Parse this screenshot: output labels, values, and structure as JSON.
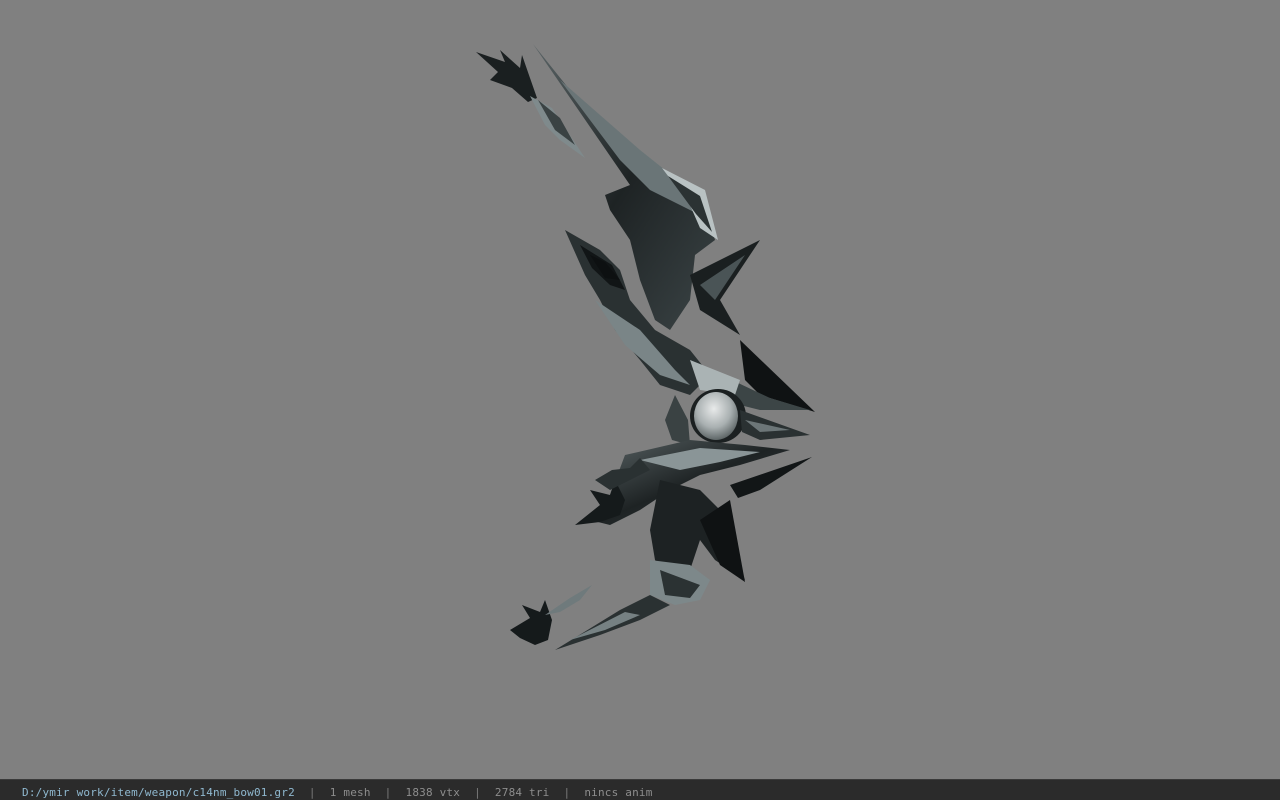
{
  "viewer": {
    "background_color": "#808080",
    "model_name": "bow-model"
  },
  "status": {
    "file_path": "D:/ymir work/item/weapon/c14nm_bow01.gr2",
    "mesh": "1 mesh",
    "vtx": "1838 vtx",
    "tri": "2784 tri",
    "anim": "nincs anim",
    "separator": "|",
    "path_color": "#8fb8cf"
  }
}
